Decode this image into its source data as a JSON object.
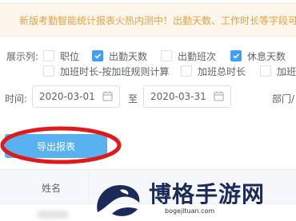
{
  "notice": {
    "text": "新版考勤智能统计报表火热内测中！出勤天数、工作时长等字段可"
  },
  "display_columns": {
    "label": "展示列:",
    "options": [
      {
        "label": "职位",
        "checked": false
      },
      {
        "label": "出勤天数",
        "checked": true
      },
      {
        "label": "出勤班次",
        "checked": false
      },
      {
        "label": "休息天数",
        "checked": true
      },
      {
        "label": "加班时长-按加班规则计算",
        "checked": false
      },
      {
        "label": "加班总时长",
        "checked": false
      },
      {
        "label": "加班",
        "checked": false
      }
    ]
  },
  "time_filter": {
    "label": "时间:",
    "start": "2020-03-01",
    "separator": "至",
    "end": "2020-03-31",
    "dept_label": "部门/"
  },
  "export_button": {
    "label": "导出报表"
  },
  "table": {
    "headers": [
      {
        "label": "姓名"
      }
    ]
  },
  "watermark": {
    "title": "博格手游网",
    "subtitle": "bogejituan.com"
  },
  "colors": {
    "accent": "#409eff",
    "button": "#5ab1ef",
    "notice_text": "#e6a23c",
    "annotation": "#e0191b"
  }
}
